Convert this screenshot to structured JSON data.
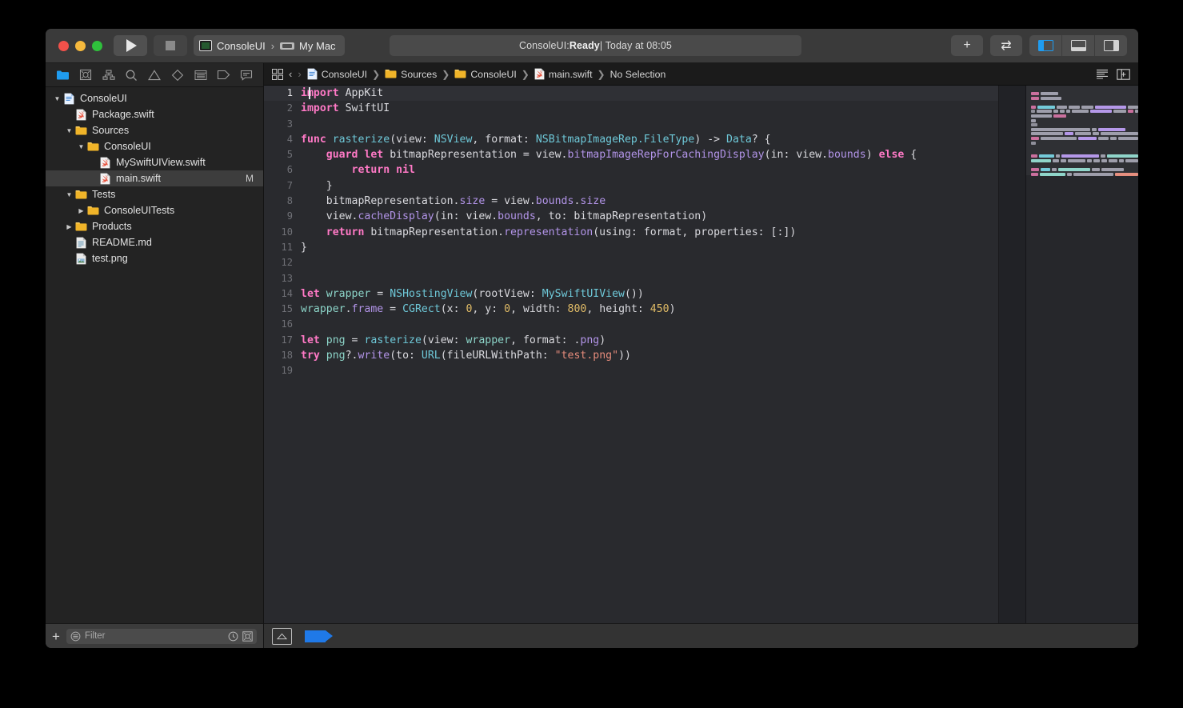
{
  "window": {
    "traffic_lights": [
      "close",
      "minimize",
      "zoom"
    ]
  },
  "toolbar": {
    "run_label": "Run",
    "stop_label": "Stop",
    "scheme": {
      "app_name": "ConsoleUI",
      "separator": "›",
      "destination": "My Mac"
    },
    "status": {
      "prefix": "ConsoleUI: ",
      "state": "Ready",
      "suffix": " | Today at 08:05"
    },
    "add_label": "+",
    "toggle_label": "⇄",
    "panes": [
      {
        "name": "navigator",
        "active": true
      },
      {
        "name": "debug-area",
        "active": false
      },
      {
        "name": "inspector",
        "active": false
      }
    ]
  },
  "navigator": {
    "tabs": [
      "project-navigator",
      "source-control-navigator",
      "hierarchy-navigator",
      "find-navigator",
      "issue-navigator",
      "breakpoint-navigator",
      "test-navigator",
      "tag-navigator",
      "report-navigator"
    ],
    "active_tab": "project-navigator",
    "tree": [
      {
        "label": "ConsoleUI",
        "depth": 0,
        "icon": "project",
        "twisty": "open",
        "selected": false,
        "badge": ""
      },
      {
        "label": "Package.swift",
        "depth": 1,
        "icon": "swift",
        "twisty": "none",
        "selected": false,
        "badge": ""
      },
      {
        "label": "Sources",
        "depth": 1,
        "icon": "folder",
        "twisty": "open",
        "selected": false,
        "badge": ""
      },
      {
        "label": "ConsoleUI",
        "depth": 2,
        "icon": "folder",
        "twisty": "open",
        "selected": false,
        "badge": ""
      },
      {
        "label": "MySwiftUIView.swift",
        "depth": 3,
        "icon": "swift",
        "twisty": "none",
        "selected": false,
        "badge": ""
      },
      {
        "label": "main.swift",
        "depth": 3,
        "icon": "swift",
        "twisty": "none",
        "selected": true,
        "badge": "M"
      },
      {
        "label": "Tests",
        "depth": 1,
        "icon": "folder",
        "twisty": "open",
        "selected": false,
        "badge": ""
      },
      {
        "label": "ConsoleUITests",
        "depth": 2,
        "icon": "folder",
        "twisty": "closed",
        "selected": false,
        "badge": ""
      },
      {
        "label": "Products",
        "depth": 1,
        "icon": "folder",
        "twisty": "closed",
        "selected": false,
        "badge": ""
      },
      {
        "label": "README.md",
        "depth": 1,
        "icon": "markdown",
        "twisty": "none",
        "selected": false,
        "badge": ""
      },
      {
        "label": "test.png",
        "depth": 1,
        "icon": "image",
        "twisty": "none",
        "selected": false,
        "badge": ""
      }
    ],
    "filter": {
      "placeholder": "Filter",
      "value": "",
      "add_label": "+",
      "recent_icon": "clock-icon",
      "scm_icon": "source-control-icon"
    }
  },
  "jumpbar": {
    "back": "‹",
    "forward": "›",
    "crumbs": [
      {
        "label": "ConsoleUI",
        "icon": "project"
      },
      {
        "label": "Sources",
        "icon": "folder"
      },
      {
        "label": "ConsoleUI",
        "icon": "folder"
      },
      {
        "label": "main.swift",
        "icon": "swift"
      },
      {
        "label": "No Selection",
        "icon": "none"
      }
    ],
    "separator": "❯",
    "minimap_toggle": "minimap-icon",
    "add_editor": "add-editor-icon"
  },
  "editor": {
    "current_line": 1,
    "total_lines": 19,
    "filename": "main.swift",
    "language": "Swift",
    "lines": [
      {
        "n": 1,
        "tokens": [
          [
            "kw",
            "import"
          ],
          [
            "pln",
            " AppKit"
          ]
        ]
      },
      {
        "n": 2,
        "tokens": [
          [
            "kw",
            "import"
          ],
          [
            "pln",
            " SwiftUI"
          ]
        ]
      },
      {
        "n": 3,
        "tokens": []
      },
      {
        "n": 4,
        "tokens": [
          [
            "kw",
            "func"
          ],
          [
            "pln",
            " "
          ],
          [
            "typ",
            "rasterize"
          ],
          [
            "pln",
            "(view: "
          ],
          [
            "typ",
            "NSView"
          ],
          [
            "pln",
            ", format: "
          ],
          [
            "typ",
            "NSBitmapImageRep.FileType"
          ],
          [
            "pln",
            ") -> "
          ],
          [
            "typ",
            "Data"
          ],
          [
            "pln",
            "? {"
          ]
        ]
      },
      {
        "n": 5,
        "tokens": [
          [
            "pln",
            "    "
          ],
          [
            "kw",
            "guard"
          ],
          [
            "pln",
            " "
          ],
          [
            "kw",
            "let"
          ],
          [
            "pln",
            " bitmapRepresentation = view."
          ],
          [
            "mth",
            "bitmapImageRepForCachingDisplay"
          ],
          [
            "pln",
            "(in: view."
          ],
          [
            "prop",
            "bounds"
          ],
          [
            "pln",
            ") "
          ],
          [
            "kw",
            "else"
          ],
          [
            "pln",
            " {"
          ]
        ]
      },
      {
        "n": 6,
        "tokens": [
          [
            "pln",
            "        "
          ],
          [
            "kw",
            "return"
          ],
          [
            "pln",
            " "
          ],
          [
            "kw",
            "nil"
          ]
        ]
      },
      {
        "n": 7,
        "tokens": [
          [
            "pln",
            "    }"
          ]
        ]
      },
      {
        "n": 8,
        "tokens": [
          [
            "pln",
            "    bitmapRepresentation."
          ],
          [
            "prop",
            "size"
          ],
          [
            "pln",
            " = view."
          ],
          [
            "prop",
            "bounds"
          ],
          [
            "pln",
            "."
          ],
          [
            "prop",
            "size"
          ]
        ]
      },
      {
        "n": 9,
        "tokens": [
          [
            "pln",
            "    view."
          ],
          [
            "mth",
            "cacheDisplay"
          ],
          [
            "pln",
            "(in: view."
          ],
          [
            "prop",
            "bounds"
          ],
          [
            "pln",
            ", to: bitmapRepresentation)"
          ]
        ]
      },
      {
        "n": 10,
        "tokens": [
          [
            "pln",
            "    "
          ],
          [
            "kw",
            "return"
          ],
          [
            "pln",
            " bitmapRepresentation."
          ],
          [
            "mth",
            "representation"
          ],
          [
            "pln",
            "(using: format, properties: [:])"
          ]
        ]
      },
      {
        "n": 11,
        "tokens": [
          [
            "pln",
            "}"
          ]
        ]
      },
      {
        "n": 12,
        "tokens": []
      },
      {
        "n": 13,
        "tokens": []
      },
      {
        "n": 14,
        "tokens": [
          [
            "kw",
            "let"
          ],
          [
            "pln",
            " "
          ],
          [
            "var",
            "wrapper"
          ],
          [
            "pln",
            " = "
          ],
          [
            "typ",
            "NSHostingView"
          ],
          [
            "pln",
            "(rootView: "
          ],
          [
            "typ",
            "MySwiftUIView"
          ],
          [
            "pln",
            "())"
          ]
        ]
      },
      {
        "n": 15,
        "tokens": [
          [
            "var",
            "wrapper"
          ],
          [
            "pln",
            "."
          ],
          [
            "prop",
            "frame"
          ],
          [
            "pln",
            " = "
          ],
          [
            "typ",
            "CGRect"
          ],
          [
            "pln",
            "(x: "
          ],
          [
            "num",
            "0"
          ],
          [
            "pln",
            ", y: "
          ],
          [
            "num",
            "0"
          ],
          [
            "pln",
            ", width: "
          ],
          [
            "num",
            "800"
          ],
          [
            "pln",
            ", height: "
          ],
          [
            "num",
            "450"
          ],
          [
            "pln",
            ")"
          ]
        ]
      },
      {
        "n": 16,
        "tokens": []
      },
      {
        "n": 17,
        "tokens": [
          [
            "kw",
            "let"
          ],
          [
            "pln",
            " "
          ],
          [
            "var",
            "png"
          ],
          [
            "pln",
            " = "
          ],
          [
            "typ",
            "rasterize"
          ],
          [
            "pln",
            "(view: "
          ],
          [
            "var",
            "wrapper"
          ],
          [
            "pln",
            ", format: ."
          ],
          [
            "mth",
            "png"
          ],
          [
            "pln",
            ")"
          ]
        ]
      },
      {
        "n": 18,
        "tokens": [
          [
            "kw",
            "try"
          ],
          [
            "pln",
            " "
          ],
          [
            "var",
            "png"
          ],
          [
            "pln",
            "?."
          ],
          [
            "mth",
            "write"
          ],
          [
            "pln",
            "(to: "
          ],
          [
            "typ",
            "URL"
          ],
          [
            "pln",
            "(fileURLWithPath: "
          ],
          [
            "str",
            "\"test.png\""
          ],
          [
            "pln",
            "))"
          ]
        ]
      },
      {
        "n": 19,
        "tokens": []
      }
    ],
    "status_icons": [
      "breakpoints-icon",
      "issue-tag-icon"
    ]
  },
  "colors": {
    "accent": "#1f9cf0",
    "keyword": "#ff79c6",
    "type": "#6ec8d8",
    "method": "#b294e8",
    "variable": "#8cd4c8",
    "number": "#e0bb66",
    "string": "#e58b7b",
    "plain": "#d9d9de",
    "editor_bg": "#292a2e",
    "navigator_bg": "#232323",
    "titlebar_bg": "#3a3a3a",
    "selection_bg": "#3d3d3d"
  },
  "minimap": {
    "rows": [
      [
        [
          10,
          "#c96a9a"
        ],
        [
          22,
          "#9a9aa8"
        ]
      ],
      [
        [
          10,
          "#c96a9a"
        ],
        [
          26,
          "#9a9aa8"
        ]
      ],
      [],
      [
        [
          10,
          "#c96a9a"
        ],
        [
          34,
          "#6ec8d8"
        ],
        [
          20,
          "#9a9aa8"
        ],
        [
          22,
          "#9a9aa8"
        ],
        [
          24,
          "#9a9aa8"
        ],
        [
          62,
          "#b294e8"
        ],
        [
          20,
          "#9a9aa8"
        ]
      ],
      [
        [
          8,
          "#8a8a96"
        ],
        [
          32,
          "#9a9aa8"
        ],
        [
          10,
          "#9a9aa8"
        ],
        [
          10,
          "#9a9aa8"
        ],
        [
          8,
          "#9a9aa8"
        ],
        [
          34,
          "#9a9aa8"
        ],
        [
          46,
          "#b294e8"
        ],
        [
          26,
          "#9a9aa8"
        ],
        [
          12,
          "#c96a9a"
        ],
        [
          6,
          "#9a9aa8"
        ]
      ],
      [
        [
          26,
          "#9a9aa8"
        ],
        [
          16,
          "#c96a9a"
        ]
      ],
      [
        [
          6,
          "#9a9aa8"
        ]
      ],
      [
        [
          8,
          "#8a8a96"
        ]
      ],
      [
        [
          74,
          "#9a9aa8"
        ],
        [
          6,
          "#9a9aa8"
        ],
        [
          34,
          "#b294e8"
        ]
      ],
      [
        [
          44,
          "#9a9aa8"
        ],
        [
          12,
          "#b294e8"
        ],
        [
          22,
          "#9a9aa8"
        ],
        [
          8,
          "#9a9aa8"
        ],
        [
          52,
          "#9a9aa8"
        ]
      ],
      [
        [
          18,
          "#c96a9a"
        ],
        [
          78,
          "#9a9aa8"
        ],
        [
          40,
          "#b294e8"
        ],
        [
          22,
          "#9a9aa8"
        ],
        [
          14,
          "#9a9aa8"
        ],
        [
          44,
          "#9a9aa8"
        ]
      ],
      [
        [
          6,
          "#8a8a96"
        ]
      ],
      [],
      [],
      [
        [
          10,
          "#c96a9a"
        ],
        [
          24,
          "#6ec8d8"
        ],
        [
          6,
          "#9a9aa8"
        ],
        [
          58,
          "#b294e8"
        ],
        [
          8,
          "#9a9aa8"
        ],
        [
          48,
          "#8cd4c8"
        ]
      ],
      [
        [
          32,
          "#8cd4c8"
        ],
        [
          10,
          "#9a9aa8"
        ],
        [
          8,
          "#9a9aa8"
        ],
        [
          28,
          "#9a9aa8"
        ],
        [
          8,
          "#9a9aa8"
        ],
        [
          10,
          "#9a9aa8"
        ],
        [
          8,
          "#9a9aa8"
        ],
        [
          14,
          "#9a9aa8"
        ],
        [
          8,
          "#9a9aa8"
        ],
        [
          20,
          "#9a9aa8"
        ]
      ],
      [],
      [
        [
          10,
          "#c96a9a"
        ],
        [
          12,
          "#6ec8d8"
        ],
        [
          6,
          "#9a9aa8"
        ],
        [
          40,
          "#8cd4c8"
        ],
        [
          10,
          "#9a9aa8"
        ],
        [
          28,
          "#9a9aa8"
        ]
      ],
      [
        [
          10,
          "#c96a9a"
        ],
        [
          36,
          "#8cd4c8"
        ],
        [
          6,
          "#9a9aa8"
        ],
        [
          56,
          "#9a9aa8"
        ],
        [
          32,
          "#e58b7b"
        ]
      ]
    ]
  }
}
